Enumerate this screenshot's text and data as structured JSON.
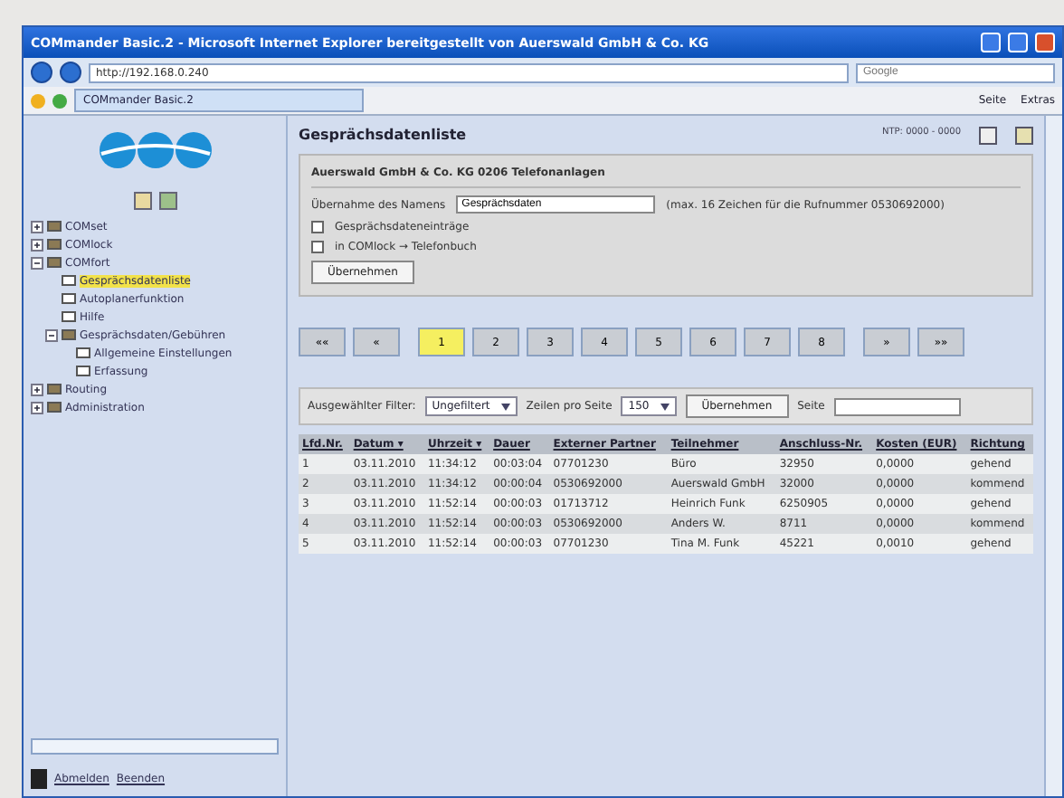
{
  "window": {
    "title": "COMmander Basic.2 - Microsoft Internet Explorer bereitgestellt von Auerswald GmbH & Co. KG"
  },
  "browser": {
    "address": "http://192.168.0.240",
    "search_placeholder": "Google",
    "tab": "COMmander Basic.2",
    "tools": [
      "Seite",
      "Extras"
    ]
  },
  "sidebar": {
    "tree": [
      {
        "label": "COMset",
        "expanded": false,
        "selected": false
      },
      {
        "label": "COMlock",
        "expanded": false,
        "selected": false
      },
      {
        "label": "COMfort",
        "expanded": true,
        "selected": false,
        "children": [
          {
            "label": "Gesprächsdatenliste",
            "selected": true
          },
          {
            "label": "Autoplanerfunktion",
            "selected": false
          },
          {
            "label": "Hilfe",
            "selected": false
          },
          {
            "label": "Gesprächsdaten/Gebühren",
            "expanded": true,
            "selected": false,
            "children": [
              {
                "label": "Allgemeine Einstellungen",
                "selected": false
              },
              {
                "label": "Erfassung",
                "selected": false
              }
            ]
          }
        ]
      },
      {
        "label": "Routing",
        "expanded": false,
        "selected": false
      },
      {
        "label": "Administration",
        "expanded": false,
        "selected": false
      }
    ],
    "footer_links": [
      "Abmelden",
      "Beenden"
    ]
  },
  "main": {
    "heading": "Gesprächsdatenliste",
    "status": "NTP: 0000 - 0000",
    "panel": {
      "title": "Auerswald GmbH & Co. KG 0206 Telefonanlagen",
      "field_label": "Übernahme des Namens",
      "field_value": "Gesprächsdaten",
      "hint": "(max. 16 Zeichen für die Rufnummer 0530692000)",
      "options": [
        {
          "label": "Gesprächsdateneinträge",
          "checked": false
        },
        {
          "label": "in COMlock → Telefonbuch",
          "checked": false
        }
      ],
      "button": "Übernehmen"
    },
    "pagination": [
      {
        "label": "««",
        "selected": false
      },
      {
        "label": "«",
        "selected": false
      },
      {
        "label": "1",
        "selected": true
      },
      {
        "label": "2",
        "selected": false
      },
      {
        "label": "3",
        "selected": false
      },
      {
        "label": "4",
        "selected": false
      },
      {
        "label": "5",
        "selected": false
      },
      {
        "label": "6",
        "selected": false
      },
      {
        "label": "7",
        "selected": false
      },
      {
        "label": "8",
        "selected": false
      },
      {
        "label": "»",
        "selected": false
      },
      {
        "label": "»»",
        "selected": false
      }
    ],
    "filter": {
      "label": "Ausgewählter Filter:",
      "value": "Ungefiltert",
      "rows_label": "Zeilen pro Seite",
      "rows_value": "150",
      "button": "Übernehmen",
      "page_label": "Seite"
    },
    "table": {
      "columns": [
        "Lfd.Nr.",
        "Datum ▾",
        "Uhrzeit ▾",
        "Dauer",
        "Externer Partner",
        "Teilnehmer",
        "Anschluss-Nr.",
        "Kosten (EUR)",
        "Richtung"
      ],
      "rows": [
        [
          "1",
          "03.11.2010",
          "11:34:12",
          "00:03:04",
          "07701230",
          "Büro",
          "32950",
          "0,0000",
          "gehend"
        ],
        [
          "2",
          "03.11.2010",
          "11:34:12",
          "00:00:04",
          "0530692000",
          "Auerswald GmbH",
          "32000",
          "0,0000",
          "kommend"
        ],
        [
          "3",
          "03.11.2010",
          "11:52:14",
          "00:00:03",
          "01713712",
          "Heinrich Funk",
          "6250905",
          "0,0000",
          "gehend"
        ],
        [
          "4",
          "03.11.2010",
          "11:52:14",
          "00:00:03",
          "0530692000",
          "Anders W.",
          "8711",
          "0,0000",
          "kommend"
        ],
        [
          "5",
          "03.11.2010",
          "11:52:14",
          "00:00:03",
          "07701230",
          "Tina M. Funk",
          "45221",
          "0,0010",
          "gehend"
        ]
      ]
    }
  }
}
